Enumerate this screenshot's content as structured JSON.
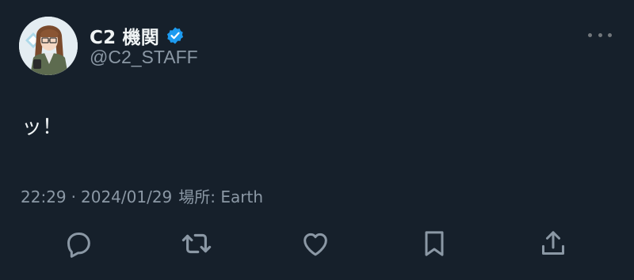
{
  "author": {
    "display_name": "C2 機関",
    "handle": "@C2_STAFF",
    "verified": true,
    "avatar_icon": "avatar"
  },
  "tweet": {
    "text": "ッ！",
    "time": "22:29",
    "separator": "·",
    "date": "2024/01/29",
    "location": "場所: Earth"
  },
  "actions": [
    "reply-icon",
    "retweet-icon",
    "like-icon",
    "bookmark-icon",
    "share-icon"
  ],
  "colors": {
    "background": "#16202b",
    "primary_text": "#eff3f4",
    "secondary_text": "#8b98a5",
    "icon": "#8b98a5",
    "verified": "#1d9bf0"
  }
}
